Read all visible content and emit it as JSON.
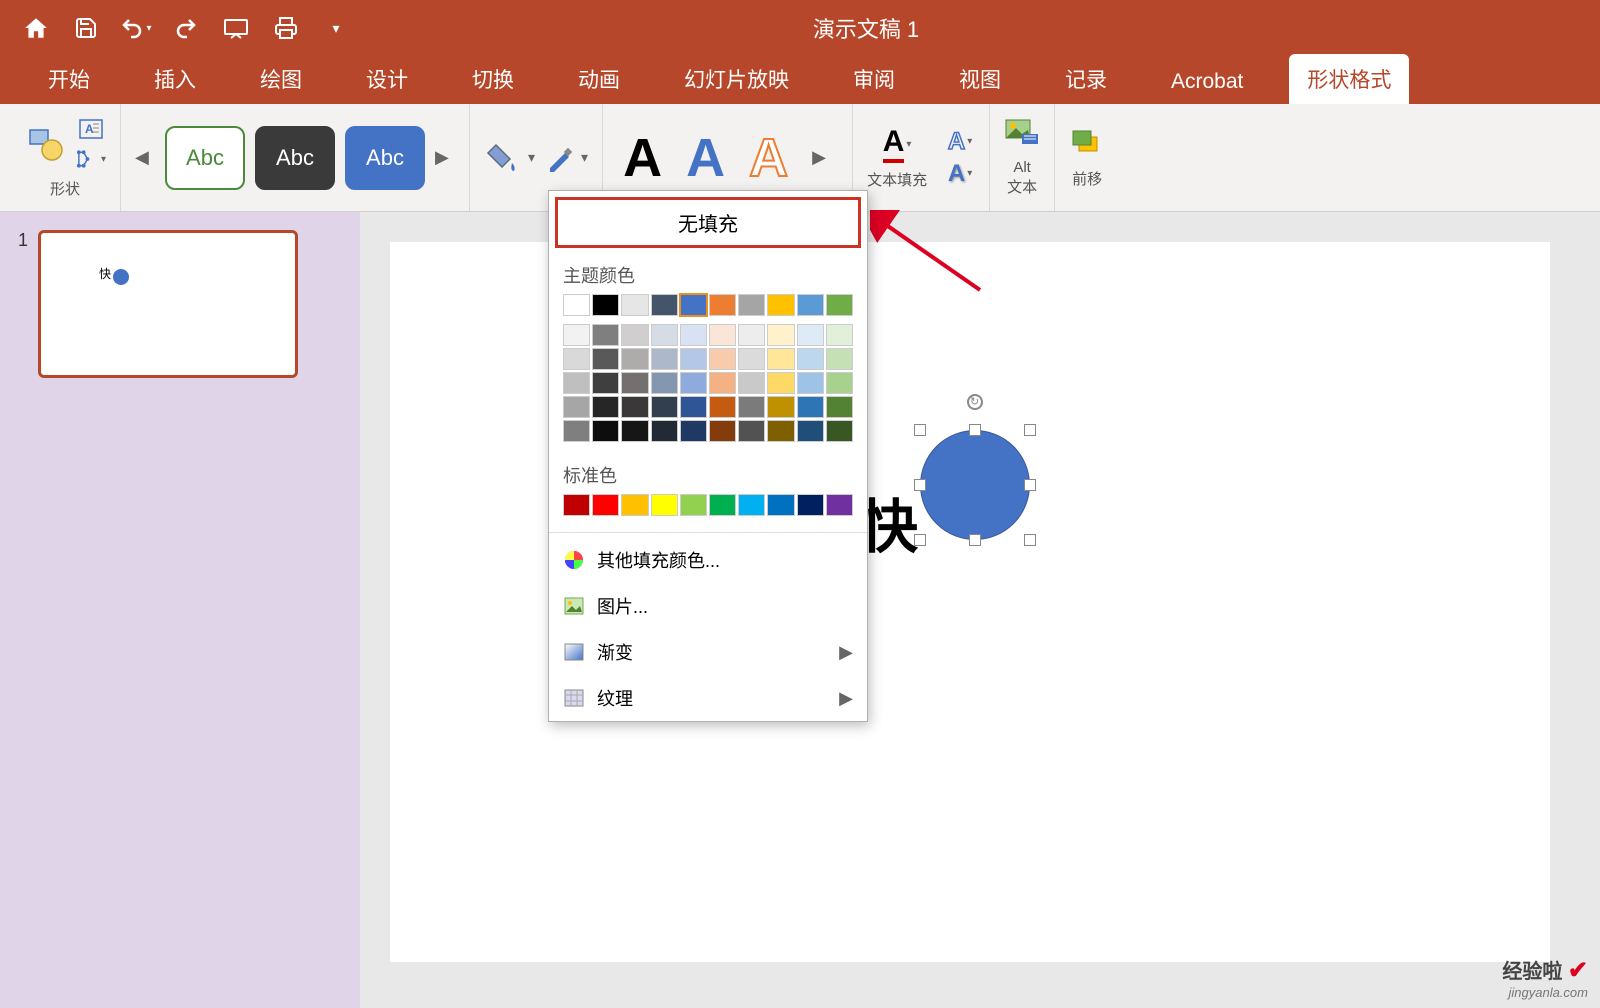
{
  "titlebar": {
    "title": "演示文稿 1"
  },
  "tabs": {
    "home": "开始",
    "insert": "插入",
    "draw": "绘图",
    "design": "设计",
    "transition": "切换",
    "animation": "动画",
    "slideshow": "幻灯片放映",
    "review": "审阅",
    "view": "视图",
    "record": "记录",
    "acrobat": "Acrobat",
    "shapeformat": "形状格式"
  },
  "ribbon": {
    "shapes_label": "形状",
    "style_abc": "Abc",
    "text_fill_label": "文本填充",
    "alt_text_label": "Alt\n文本",
    "bring_forward": "前移"
  },
  "dropdown": {
    "no_fill": "无填充",
    "theme_colors": "主题颜色",
    "standard_colors": "标准色",
    "more_colors": "其他填充颜色...",
    "picture": "图片...",
    "gradient": "渐变",
    "texture": "纹理"
  },
  "theme_colors_row1": [
    "#ffffff",
    "#000000",
    "#e7e6e6",
    "#44546a",
    "#4472c4",
    "#ed7d31",
    "#a5a5a5",
    "#ffc000",
    "#5b9bd5",
    "#70ad47"
  ],
  "theme_tints": [
    [
      "#f2f2f2",
      "#7f7f7f",
      "#d0cece",
      "#d6dce5",
      "#d9e2f3",
      "#fbe5d6",
      "#ededed",
      "#fff2cc",
      "#deebf7",
      "#e2f0d9"
    ],
    [
      "#d9d9d9",
      "#595959",
      "#aeabab",
      "#adb9ca",
      "#b4c7e7",
      "#f8cbad",
      "#dbdbdb",
      "#ffe699",
      "#bdd7ee",
      "#c5e0b4"
    ],
    [
      "#bfbfbf",
      "#3f3f3f",
      "#757070",
      "#8497b0",
      "#8faadc",
      "#f4b183",
      "#c9c9c9",
      "#ffd966",
      "#9dc3e6",
      "#a9d18e"
    ],
    [
      "#a6a6a6",
      "#262626",
      "#3a3838",
      "#323f4f",
      "#2f5597",
      "#c55a11",
      "#7b7b7b",
      "#bf9000",
      "#2e75b6",
      "#548235"
    ],
    [
      "#7f7f7f",
      "#0d0d0d",
      "#171616",
      "#222a35",
      "#1f3864",
      "#843c0c",
      "#525252",
      "#7f6000",
      "#1f4e79",
      "#385723"
    ]
  ],
  "standard_colors": [
    "#c00000",
    "#ff0000",
    "#ffc000",
    "#ffff00",
    "#92d050",
    "#00b050",
    "#00b0f0",
    "#0070c0",
    "#002060",
    "#7030a0"
  ],
  "slide": {
    "number": "1",
    "text_fragment": "快",
    "thumb_text": "快"
  },
  "watermark": {
    "line1": "经验啦",
    "line2": "jingyanla.com"
  }
}
